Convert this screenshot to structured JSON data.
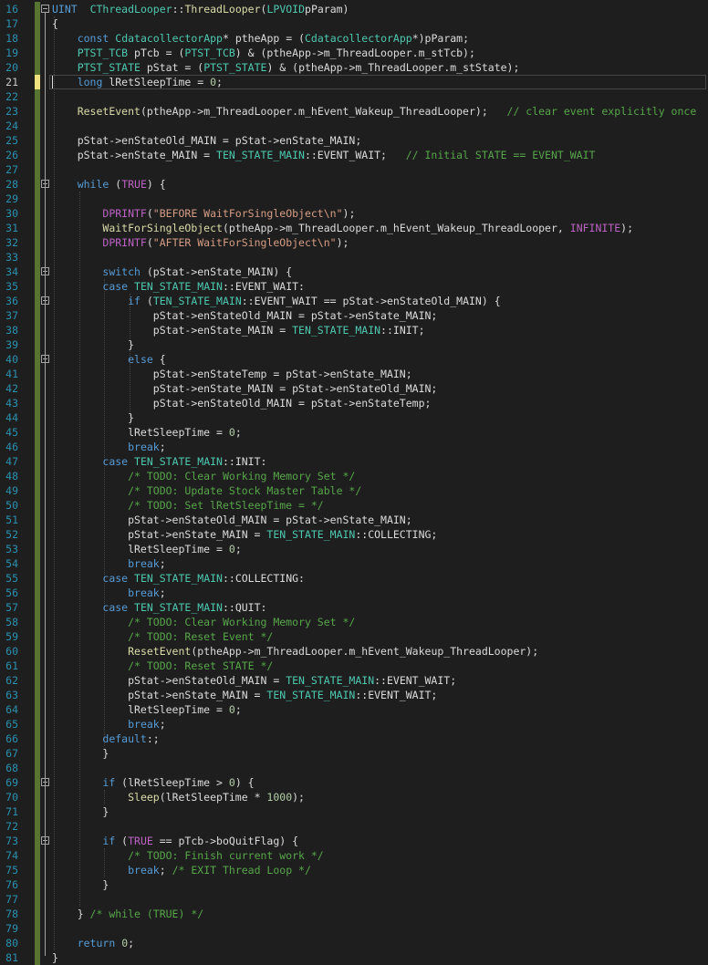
{
  "editor": {
    "language": "cpp",
    "current_line": 21,
    "colors": {
      "background": "#1e1e1e",
      "line_number": "#2b91af",
      "keyword": "#569cd6",
      "type": "#4ec9b0",
      "function": "#dcdcaa",
      "string": "#d69d85",
      "comment": "#57a64a",
      "number": "#b5cea8",
      "macro": "#bd63c5",
      "change_bar": "#577430"
    },
    "lines": [
      {
        "n": "16",
        "segs": [
          [
            "kw",
            "UINT"
          ],
          [
            "",
            "  "
          ],
          [
            "ty",
            "CThreadLooper"
          ],
          [
            "",
            "::"
          ],
          [
            "fn",
            "ThreadLooper"
          ],
          [
            "",
            "("
          ],
          [
            "ty",
            "LPVOID"
          ],
          [
            "",
            ""
          ],
          [
            "",
            "pParam)"
          ]
        ]
      },
      {
        "n": "17",
        "segs": [
          [
            "",
            "{"
          ]
        ]
      },
      {
        "n": "18",
        "segs": [
          [
            "",
            "    "
          ],
          [
            "kw",
            "const"
          ],
          [
            "",
            " "
          ],
          [
            "ty",
            "CdatacollectorApp"
          ],
          [
            "",
            "* "
          ],
          [
            "",
            "ptheApp = ("
          ],
          [
            "ty",
            "CdatacollectorApp"
          ],
          [
            "",
            "*)pParam;"
          ]
        ]
      },
      {
        "n": "19",
        "segs": [
          [
            "",
            "    "
          ],
          [
            "ty",
            "PTST_TCB"
          ],
          [
            "",
            " pTcb = ("
          ],
          [
            "ty",
            "PTST_TCB"
          ],
          [
            "",
            ") & (ptheApp->m_ThreadLooper.m_stTcb);"
          ]
        ]
      },
      {
        "n": "20",
        "segs": [
          [
            "",
            "    "
          ],
          [
            "ty",
            "PTST_STATE"
          ],
          [
            "",
            " pStat = ("
          ],
          [
            "ty",
            "PTST_STATE"
          ],
          [
            "",
            ") & (ptheApp->m_ThreadLooper.m_stState);"
          ]
        ]
      },
      {
        "n": "21",
        "segs": [
          [
            "",
            "    "
          ],
          [
            "kw",
            "long"
          ],
          [
            "",
            " lRetSleepTime = "
          ],
          [
            "num",
            "0"
          ],
          [
            "",
            ";"
          ]
        ]
      },
      {
        "n": "22",
        "segs": [
          [
            "",
            ""
          ]
        ]
      },
      {
        "n": "23",
        "segs": [
          [
            "",
            "    "
          ],
          [
            "fn",
            "ResetEvent"
          ],
          [
            "",
            "(ptheApp->m_ThreadLooper.m_hEvent_Wakeup_ThreadLooper);   "
          ],
          [
            "cm",
            "// clear event explicitly once"
          ]
        ]
      },
      {
        "n": "24",
        "segs": [
          [
            "",
            ""
          ]
        ]
      },
      {
        "n": "25",
        "segs": [
          [
            "",
            "    pStat->enStateOld_MAIN = pStat->enState_MAIN;"
          ]
        ]
      },
      {
        "n": "26",
        "segs": [
          [
            "",
            "    pStat->enState_MAIN = "
          ],
          [
            "ty",
            "TEN_STATE_MAIN"
          ],
          [
            "",
            "::EVENT_WAIT;   "
          ],
          [
            "cm",
            "// Initial STATE == EVENT_WAIT"
          ]
        ]
      },
      {
        "n": "27",
        "segs": [
          [
            "",
            ""
          ]
        ]
      },
      {
        "n": "28",
        "segs": [
          [
            "",
            "    "
          ],
          [
            "kw",
            "while"
          ],
          [
            "",
            " ("
          ],
          [
            "mac",
            "TRUE"
          ],
          [
            "",
            ") {"
          ]
        ]
      },
      {
        "n": "29",
        "segs": [
          [
            "",
            ""
          ]
        ]
      },
      {
        "n": "30",
        "segs": [
          [
            "",
            "        "
          ],
          [
            "mac",
            "DPRINTF"
          ],
          [
            "",
            "("
          ],
          [
            "str",
            "\"BEFORE WaitForSingleObject\\n\""
          ],
          [
            "",
            ");"
          ]
        ]
      },
      {
        "n": "31",
        "segs": [
          [
            "",
            "        "
          ],
          [
            "fn",
            "WaitForSingleObject"
          ],
          [
            "",
            "(ptheApp->m_ThreadLooper.m_hEvent_Wakeup_ThreadLooper, "
          ],
          [
            "mac",
            "INFINITE"
          ],
          [
            "",
            ");"
          ]
        ]
      },
      {
        "n": "32",
        "segs": [
          [
            "",
            "        "
          ],
          [
            "mac",
            "DPRINTF"
          ],
          [
            "",
            "("
          ],
          [
            "str",
            "\"AFTER WaitForSingleObject\\n\""
          ],
          [
            "",
            ");"
          ]
        ]
      },
      {
        "n": "33",
        "segs": [
          [
            "",
            ""
          ]
        ]
      },
      {
        "n": "34",
        "segs": [
          [
            "",
            "        "
          ],
          [
            "kw",
            "switch"
          ],
          [
            "",
            " (pStat->enState_MAIN) {"
          ]
        ]
      },
      {
        "n": "35",
        "segs": [
          [
            "",
            "        "
          ],
          [
            "kw",
            "case"
          ],
          [
            "",
            " "
          ],
          [
            "ty",
            "TEN_STATE_MAIN"
          ],
          [
            "",
            "::EVENT_WAIT:"
          ]
        ]
      },
      {
        "n": "36",
        "segs": [
          [
            "",
            "            "
          ],
          [
            "kw",
            "if"
          ],
          [
            "",
            " ("
          ],
          [
            "ty",
            "TEN_STATE_MAIN"
          ],
          [
            "",
            "::EVENT_WAIT == pStat->enStateOld_MAIN) {"
          ]
        ]
      },
      {
        "n": "37",
        "segs": [
          [
            "",
            "                pStat->enStateOld_MAIN = pStat->enState_MAIN;"
          ]
        ]
      },
      {
        "n": "38",
        "segs": [
          [
            "",
            "                pStat->enState_MAIN = "
          ],
          [
            "ty",
            "TEN_STATE_MAIN"
          ],
          [
            "",
            "::INIT;"
          ]
        ]
      },
      {
        "n": "39",
        "segs": [
          [
            "",
            "            }"
          ]
        ]
      },
      {
        "n": "40",
        "segs": [
          [
            "",
            "            "
          ],
          [
            "kw",
            "else"
          ],
          [
            "",
            " {"
          ]
        ]
      },
      {
        "n": "41",
        "segs": [
          [
            "",
            "                pStat->enStateTemp = pStat->enState_MAIN;"
          ]
        ]
      },
      {
        "n": "42",
        "segs": [
          [
            "",
            "                pStat->enState_MAIN = pStat->enStateOld_MAIN;"
          ]
        ]
      },
      {
        "n": "43",
        "segs": [
          [
            "",
            "                pStat->enStateOld_MAIN = pStat->enStateTemp;"
          ]
        ]
      },
      {
        "n": "44",
        "segs": [
          [
            "",
            "            }"
          ]
        ]
      },
      {
        "n": "45",
        "segs": [
          [
            "",
            "            lRetSleepTime = "
          ],
          [
            "num",
            "0"
          ],
          [
            "",
            ";"
          ]
        ]
      },
      {
        "n": "46",
        "segs": [
          [
            "",
            "            "
          ],
          [
            "kw",
            "break"
          ],
          [
            "",
            ";"
          ]
        ]
      },
      {
        "n": "47",
        "segs": [
          [
            "",
            "        "
          ],
          [
            "kw",
            "case"
          ],
          [
            "",
            " "
          ],
          [
            "ty",
            "TEN_STATE_MAIN"
          ],
          [
            "",
            "::INIT:"
          ]
        ]
      },
      {
        "n": "48",
        "segs": [
          [
            "",
            "            "
          ],
          [
            "cm",
            "/* TODO: Clear Working Memory Set */"
          ]
        ]
      },
      {
        "n": "49",
        "segs": [
          [
            "",
            "            "
          ],
          [
            "cm",
            "/* TODO: Update Stock Master Table */"
          ]
        ]
      },
      {
        "n": "50",
        "segs": [
          [
            "",
            "            "
          ],
          [
            "cm",
            "/* TODO: Set lRetSleepTime = */"
          ]
        ]
      },
      {
        "n": "51",
        "segs": [
          [
            "",
            "            pStat->enStateOld_MAIN = pStat->enState_MAIN;"
          ]
        ]
      },
      {
        "n": "52",
        "segs": [
          [
            "",
            "            pStat->enState_MAIN = "
          ],
          [
            "ty",
            "TEN_STATE_MAIN"
          ],
          [
            "",
            "::COLLECTING;"
          ]
        ]
      },
      {
        "n": "53",
        "segs": [
          [
            "",
            "            lRetSleepTime = "
          ],
          [
            "num",
            "0"
          ],
          [
            "",
            ";"
          ]
        ]
      },
      {
        "n": "54",
        "segs": [
          [
            "",
            "            "
          ],
          [
            "kw",
            "break"
          ],
          [
            "",
            ";"
          ]
        ]
      },
      {
        "n": "55",
        "segs": [
          [
            "",
            "        "
          ],
          [
            "kw",
            "case"
          ],
          [
            "",
            " "
          ],
          [
            "ty",
            "TEN_STATE_MAIN"
          ],
          [
            "",
            "::COLLECTING:"
          ]
        ]
      },
      {
        "n": "56",
        "segs": [
          [
            "",
            "            "
          ],
          [
            "kw",
            "break"
          ],
          [
            "",
            ";"
          ]
        ]
      },
      {
        "n": "57",
        "segs": [
          [
            "",
            "        "
          ],
          [
            "kw",
            "case"
          ],
          [
            "",
            " "
          ],
          [
            "ty",
            "TEN_STATE_MAIN"
          ],
          [
            "",
            "::QUIT:"
          ]
        ]
      },
      {
        "n": "58",
        "segs": [
          [
            "",
            "            "
          ],
          [
            "cm",
            "/* TODO: Clear Working Memory Set */"
          ]
        ]
      },
      {
        "n": "59",
        "segs": [
          [
            "",
            "            "
          ],
          [
            "cm",
            "/* TODO: Reset Event */"
          ]
        ]
      },
      {
        "n": "60",
        "segs": [
          [
            "",
            "            "
          ],
          [
            "fn",
            "ResetEvent"
          ],
          [
            "",
            "(ptheApp->m_ThreadLooper.m_hEvent_Wakeup_ThreadLooper);"
          ]
        ]
      },
      {
        "n": "61",
        "segs": [
          [
            "",
            "            "
          ],
          [
            "cm",
            "/* TODO: Reset STATE */"
          ]
        ]
      },
      {
        "n": "62",
        "segs": [
          [
            "",
            "            pStat->enStateOld_MAIN = "
          ],
          [
            "ty",
            "TEN_STATE_MAIN"
          ],
          [
            "",
            "::EVENT_WAIT;"
          ]
        ]
      },
      {
        "n": "63",
        "segs": [
          [
            "",
            "            pStat->enState_MAIN = "
          ],
          [
            "ty",
            "TEN_STATE_MAIN"
          ],
          [
            "",
            "::EVENT_WAIT;"
          ]
        ]
      },
      {
        "n": "64",
        "segs": [
          [
            "",
            "            lRetSleepTime = "
          ],
          [
            "num",
            "0"
          ],
          [
            "",
            ";"
          ]
        ]
      },
      {
        "n": "65",
        "segs": [
          [
            "",
            "            "
          ],
          [
            "kw",
            "break"
          ],
          [
            "",
            ";"
          ]
        ]
      },
      {
        "n": "66",
        "segs": [
          [
            "",
            "        "
          ],
          [
            "kw",
            "default"
          ],
          [
            "",
            ":;"
          ]
        ]
      },
      {
        "n": "67",
        "segs": [
          [
            "",
            "        }"
          ]
        ]
      },
      {
        "n": "68",
        "segs": [
          [
            "",
            ""
          ]
        ]
      },
      {
        "n": "69",
        "segs": [
          [
            "",
            "        "
          ],
          [
            "kw",
            "if"
          ],
          [
            "",
            " (lRetSleepTime > "
          ],
          [
            "num",
            "0"
          ],
          [
            "",
            ") {"
          ]
        ]
      },
      {
        "n": "70",
        "segs": [
          [
            "",
            "            "
          ],
          [
            "fn",
            "Sleep"
          ],
          [
            "",
            "(lRetSleepTime * "
          ],
          [
            "num",
            "1000"
          ],
          [
            "",
            ");"
          ]
        ]
      },
      {
        "n": "71",
        "segs": [
          [
            "",
            "        }"
          ]
        ]
      },
      {
        "n": "72",
        "segs": [
          [
            "",
            ""
          ]
        ]
      },
      {
        "n": "73",
        "segs": [
          [
            "",
            "        "
          ],
          [
            "kw",
            "if"
          ],
          [
            "",
            " ("
          ],
          [
            "mac",
            "TRUE"
          ],
          [
            "",
            " == pTcb->boQuitFlag) {"
          ]
        ]
      },
      {
        "n": "74",
        "segs": [
          [
            "",
            "            "
          ],
          [
            "cm",
            "/* TODO: Finish current work */"
          ]
        ]
      },
      {
        "n": "75",
        "segs": [
          [
            "",
            "            "
          ],
          [
            "kw",
            "break"
          ],
          [
            "",
            "; "
          ],
          [
            "cm",
            "/* EXIT Thread Loop */"
          ]
        ]
      },
      {
        "n": "76",
        "segs": [
          [
            "",
            "        }"
          ]
        ]
      },
      {
        "n": "77",
        "segs": [
          [
            "",
            ""
          ]
        ]
      },
      {
        "n": "78",
        "segs": [
          [
            "",
            "    } "
          ],
          [
            "cm",
            "/* while (TRUE) */"
          ]
        ]
      },
      {
        "n": "79",
        "segs": [
          [
            "",
            ""
          ]
        ]
      },
      {
        "n": "80",
        "segs": [
          [
            "",
            "    "
          ],
          [
            "kw",
            "return"
          ],
          [
            "",
            " "
          ],
          [
            "num",
            "0"
          ],
          [
            "",
            ";"
          ]
        ]
      },
      {
        "n": "81",
        "segs": [
          [
            "",
            "}"
          ]
        ]
      }
    ]
  }
}
